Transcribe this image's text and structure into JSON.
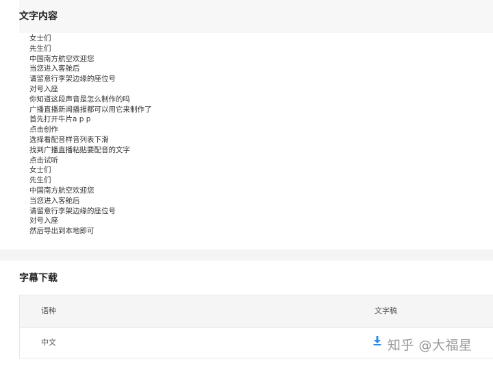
{
  "text_section": {
    "title": "文字内容",
    "lines": [
      "女士们",
      "先生们",
      "中国南方航空欢迎您",
      "当您进入客舱后",
      "请留意行李架边缘的座位号",
      "对号入座",
      "你知道这段声音是怎么制作的吗",
      "广播直播新闻播报都可以用它来制作了",
      "首先打开牛片a p p",
      "点击创作",
      "选择看配音样音列表下滑",
      "找到广播直播粘贴要配音的文字",
      "点击试听",
      "女士们",
      "先生们",
      "中国南方航空欢迎您",
      "当您进入客舱后",
      "请留意行李架边缘的座位号",
      "对号入座",
      "然后导出到本地即可"
    ]
  },
  "subtitle_section": {
    "title": "字幕下载",
    "columns": [
      "语种",
      "文字稿"
    ],
    "rows": [
      {
        "language": "中文",
        "download_icon": "download-icon"
      }
    ]
  },
  "watermark": "知乎 @大福星",
  "colors": {
    "accent": "#2d8cf0",
    "background": "#f4f4f4",
    "panel": "#ffffff"
  }
}
